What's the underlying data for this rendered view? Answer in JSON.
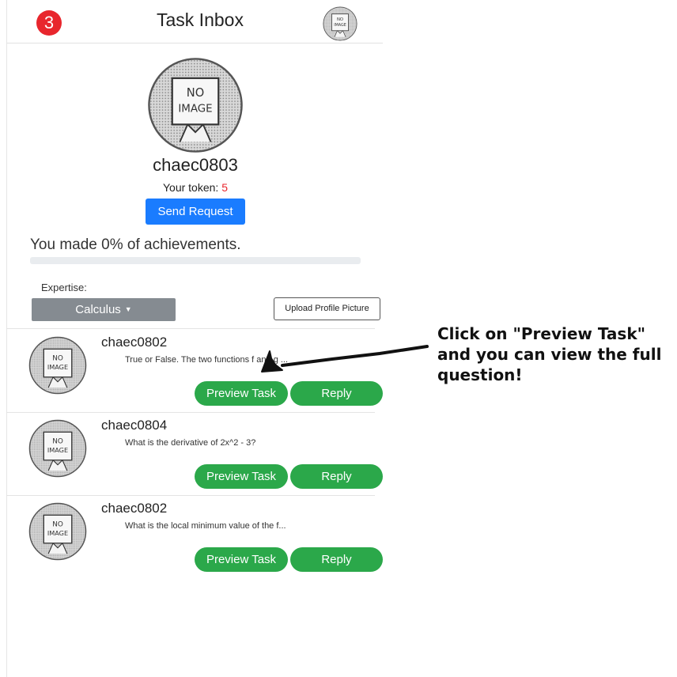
{
  "header": {
    "badge": "3",
    "title": "Task Inbox",
    "avatar_icon": "no-image-avatar"
  },
  "profile": {
    "username": "chaec0803",
    "token_label": "Your token:",
    "token_value": "5",
    "send_request_label": "Send Request",
    "achievement_text": "You made 0% of achievements.",
    "achievement_progress": 0
  },
  "expertise": {
    "label": "Expertise:",
    "selected": "Calculus",
    "upload_label": "Upload Profile Picture"
  },
  "tasks": [
    {
      "user": "chaec0802",
      "preview": "True or False. The two functions f and g ...",
      "preview_button": "Preview Task",
      "reply_button": "Reply"
    },
    {
      "user": "chaec0804",
      "preview": "What is the derivative of 2x^2 - 3?",
      "preview_button": "Preview Task",
      "reply_button": "Reply"
    },
    {
      "user": "chaec0802",
      "preview": "What is the local minimum value of the f...",
      "preview_button": "Preview Task",
      "reply_button": "Reply"
    }
  ],
  "annotation": {
    "line1": "Click on \"Preview Task\"",
    "line2": "and you can view the full",
    "line3": "question!"
  },
  "colors": {
    "badge": "#e8262d",
    "primary": "#1a7cff",
    "success": "#2ba84a",
    "dropdown": "#858b91"
  }
}
